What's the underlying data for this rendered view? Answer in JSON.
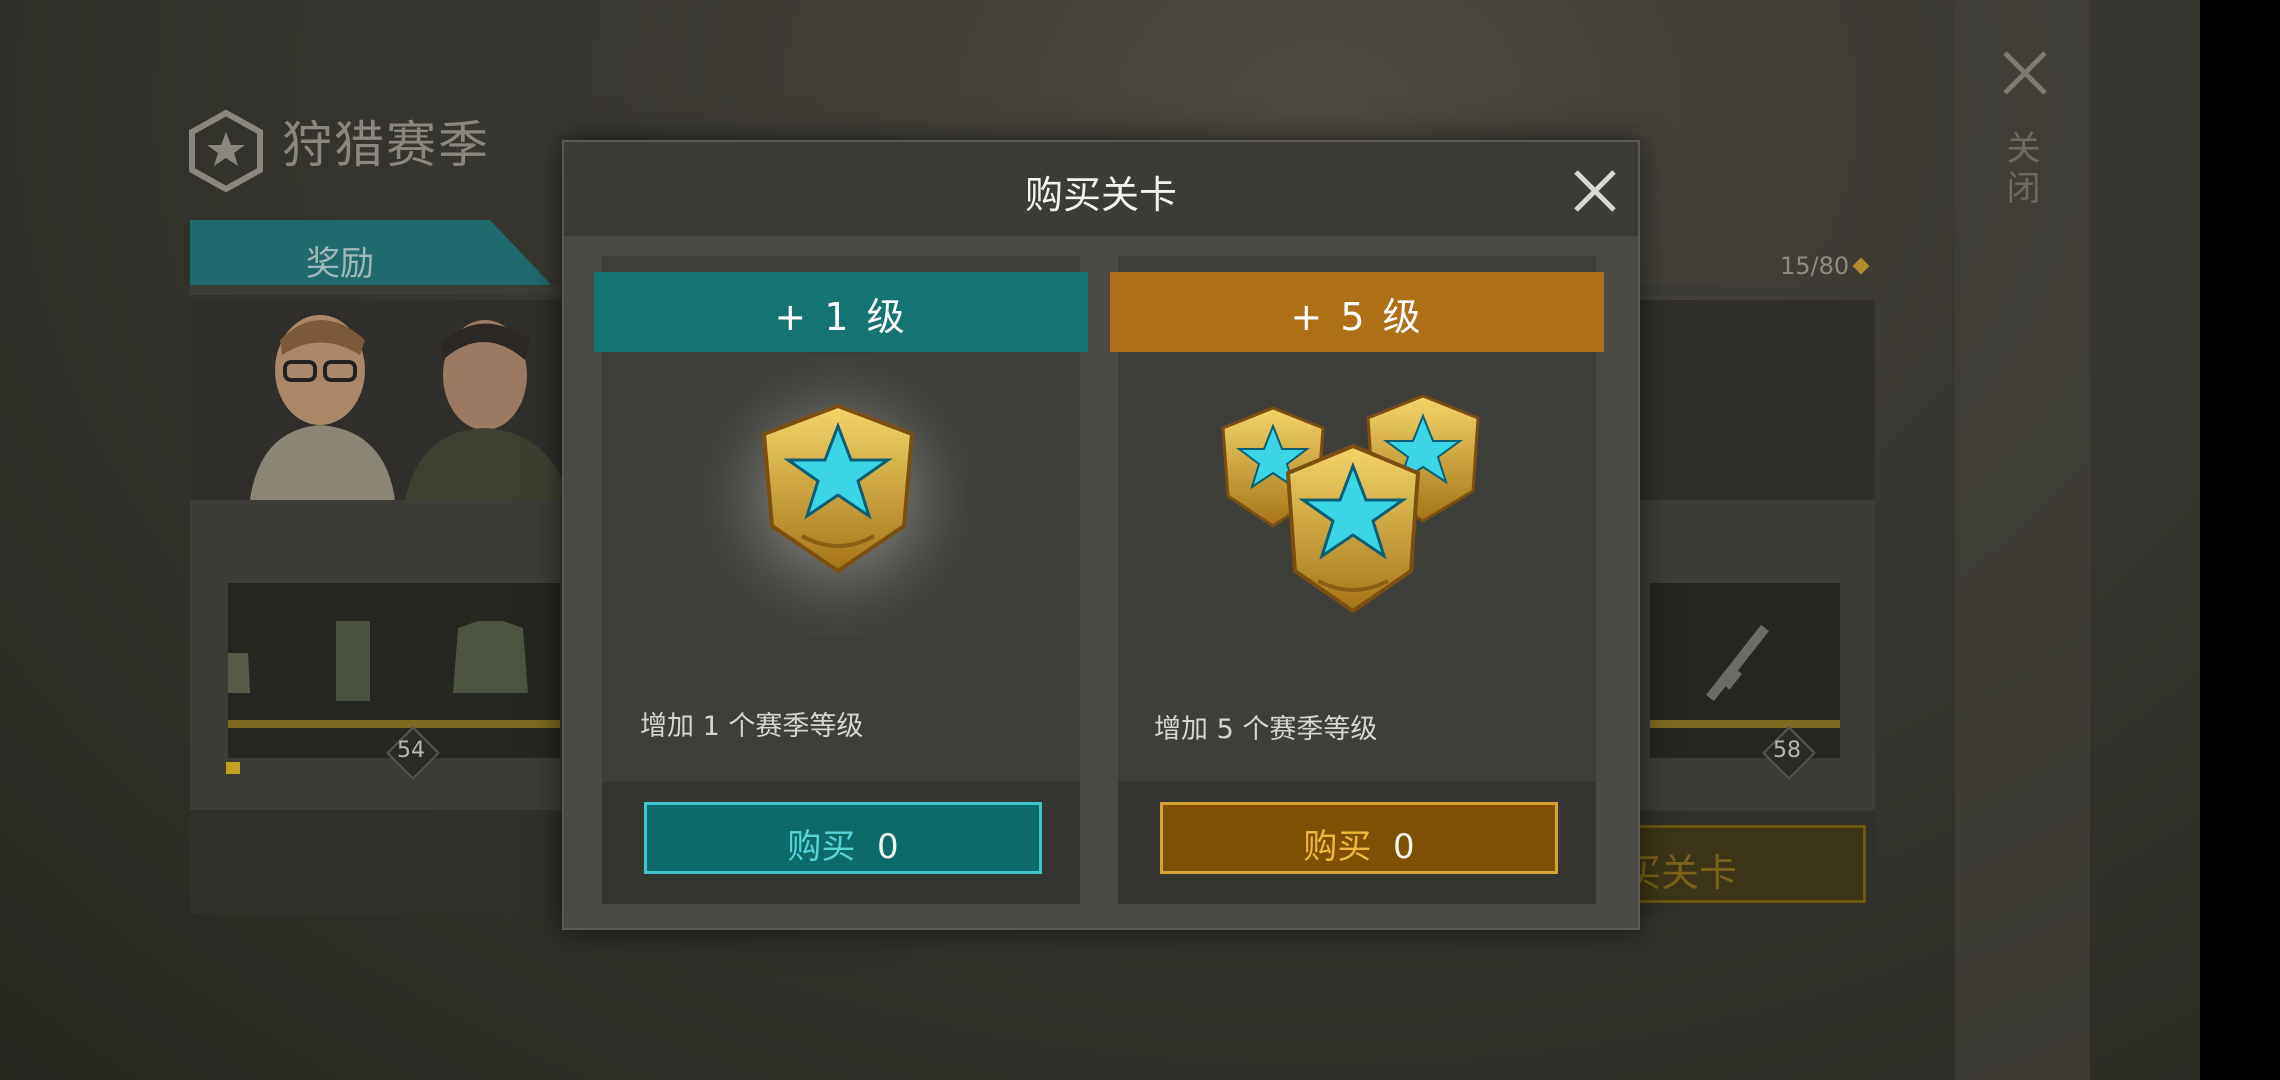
{
  "background": {
    "season_title": "狩猎赛季",
    "reward_tab": "奖励",
    "progress": "15/80",
    "level_badges": [
      "54",
      "58"
    ],
    "buy_button_partial": "买关卡",
    "side_close_label": "关闭"
  },
  "modal": {
    "title": "购买关卡",
    "cards": [
      {
        "header": "+ 1 级",
        "desc": "增加 1 个赛季等级",
        "buy_label": "购买",
        "price": "0",
        "color": "#137472"
      },
      {
        "header": "+ 5 级",
        "desc": "增加 5 个赛季等级",
        "buy_label": "购买",
        "price": "0",
        "color": "#ae6f17"
      }
    ]
  },
  "colors": {
    "teal": "#137472",
    "orange": "#ae6f17",
    "gold": "#c9a135",
    "cyan": "#3ad6e8"
  }
}
